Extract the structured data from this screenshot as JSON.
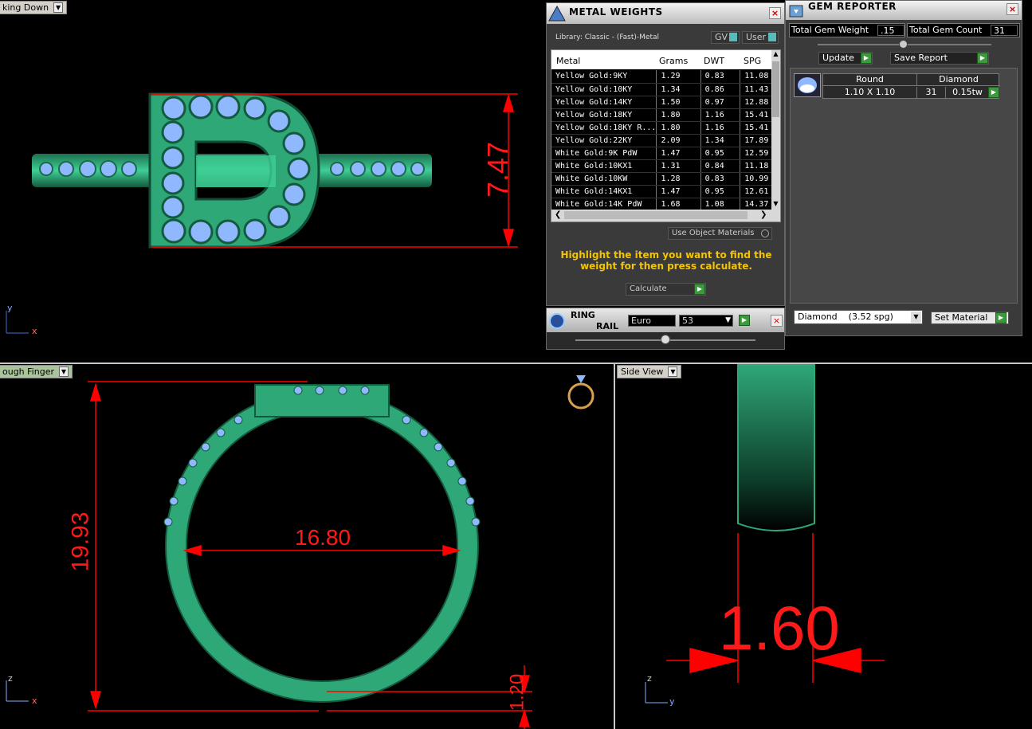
{
  "viewports": {
    "top_left": {
      "label": "king Down"
    },
    "bottom_left": {
      "label": "ough Finger"
    },
    "bottom_right": {
      "label": "Side View"
    }
  },
  "dimensions": {
    "height_top": "7.47",
    "ring_height": "19.93",
    "inner_diameter": "16.80",
    "thickness": "1.20",
    "width_side": "1.60"
  },
  "axes": {
    "y": "y",
    "x": "x",
    "z": "z"
  },
  "metal_weights": {
    "title": "METAL WEIGHTS",
    "close": "×",
    "library": "Library: Classic - (Fast)-Metal",
    "gv_label": "GV",
    "user_label": "User",
    "columns": [
      "Metal",
      "Grams",
      "DWT",
      "SPG"
    ],
    "rows": [
      [
        "Yellow Gold:9KY",
        "1.29",
        "0.83",
        "11.08"
      ],
      [
        "Yellow Gold:10KY",
        "1.34",
        "0.86",
        "11.43"
      ],
      [
        "Yellow Gold:14KY",
        "1.50",
        "0.97",
        "12.88"
      ],
      [
        "Yellow Gold:18KY",
        "1.80",
        "1.16",
        "15.41"
      ],
      [
        "Yellow Gold:18KY R...",
        "1.80",
        "1.16",
        "15.41"
      ],
      [
        "Yellow Gold:22KY",
        "2.09",
        "1.34",
        "17.89"
      ],
      [
        "White Gold:9K PdW",
        "1.47",
        "0.95",
        "12.59"
      ],
      [
        "White Gold:10KX1",
        "1.31",
        "0.84",
        "11.18"
      ],
      [
        "White Gold:10KW",
        "1.28",
        "0.83",
        "10.99"
      ],
      [
        "White Gold:14KX1",
        "1.47",
        "0.95",
        "12.61"
      ],
      [
        "White Gold:14K PdW",
        "1.68",
        "1.08",
        "14.37"
      ]
    ],
    "use_object_materials": "Use Object Materials",
    "hint": "Highlight the item you want to find the weight for then press calculate.",
    "calculate": "Calculate"
  },
  "ring_rail": {
    "title_line1": "RING",
    "title_line2": "RAIL",
    "standard": "Euro",
    "size": "53",
    "close": "×"
  },
  "gem_reporter": {
    "title": "GEM REPORTER",
    "close": "×",
    "total_weight_label": "Total Gem Weight",
    "total_weight_value": ".15",
    "total_count_label": "Total Gem Count",
    "total_count_value": "31",
    "update": "Update",
    "save_report": "Save Report",
    "gem": {
      "shape": "Round",
      "material": "Diamond",
      "size": "1.10 X 1.10",
      "count": "31",
      "weight": "0.15tw"
    },
    "material_select": "Diamond    (3.52 spg)",
    "set_material": "Set Material"
  },
  "colors": {
    "metal": "#2fa878",
    "gem": "#8fb8ff",
    "dimension": "#ff0000"
  }
}
